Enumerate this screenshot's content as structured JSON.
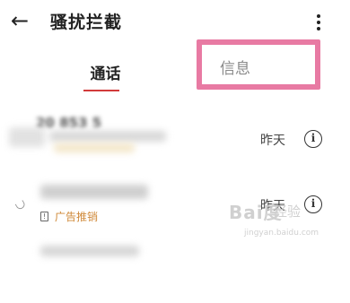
{
  "header": {
    "back_icon": "arrow-left-icon",
    "title": "骚扰拦截",
    "more_icon": "more-vertical-icon"
  },
  "tabs": [
    {
      "label": "通话",
      "active": true
    },
    {
      "label": "信息",
      "active": false,
      "highlight_color": "#e87aa3"
    }
  ],
  "accent_color": "#d23b3b",
  "calls": [
    {
      "number": "20 853 5",
      "date": "昨天",
      "info_icon": "info-icon"
    },
    {
      "number": "",
      "date": "昨天",
      "tag": "广告推销",
      "tag_color": "#d08a3a",
      "info_icon": "info-icon"
    }
  ],
  "watermark": {
    "logo": "Bai度",
    "sub": "经验",
    "url": "jingyan.baidu.com"
  }
}
